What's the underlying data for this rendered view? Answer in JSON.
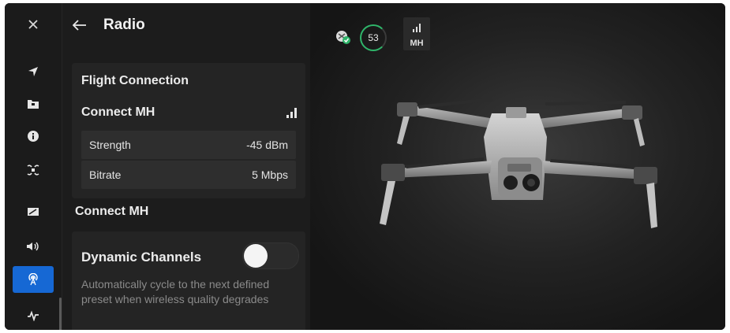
{
  "rail": {
    "items": [
      {
        "name": "close-icon",
        "active": false
      },
      {
        "name": "navigation-arrow-icon",
        "active": false
      },
      {
        "name": "folder-icon",
        "active": false
      },
      {
        "name": "info-icon",
        "active": false
      },
      {
        "name": "drone-icon",
        "active": false
      },
      {
        "name": "display-icon",
        "active": false
      },
      {
        "name": "speaker-icon",
        "active": false
      },
      {
        "name": "radio-antenna-icon",
        "active": true
      },
      {
        "name": "pulse-icon",
        "active": false
      }
    ]
  },
  "panel": {
    "title": "Radio",
    "flight_connection": {
      "title": "Flight Connection",
      "connect_label": "Connect MH",
      "rows": [
        {
          "label": "Strength",
          "value": "-45 dBm"
        },
        {
          "label": "Bitrate",
          "value": "5 Mbps"
        }
      ]
    },
    "connect_section_label": "Connect MH",
    "dynamic_channels": {
      "title": "Dynamic Channels",
      "enabled": false,
      "description": "Automatically cycle to the next defined preset when wireless quality degrades"
    }
  },
  "status": {
    "battery": "53",
    "signal_label": "MH"
  },
  "colors": {
    "accent": "#1668d4",
    "battery_ring": "#2fb56a",
    "background": "#151515"
  }
}
